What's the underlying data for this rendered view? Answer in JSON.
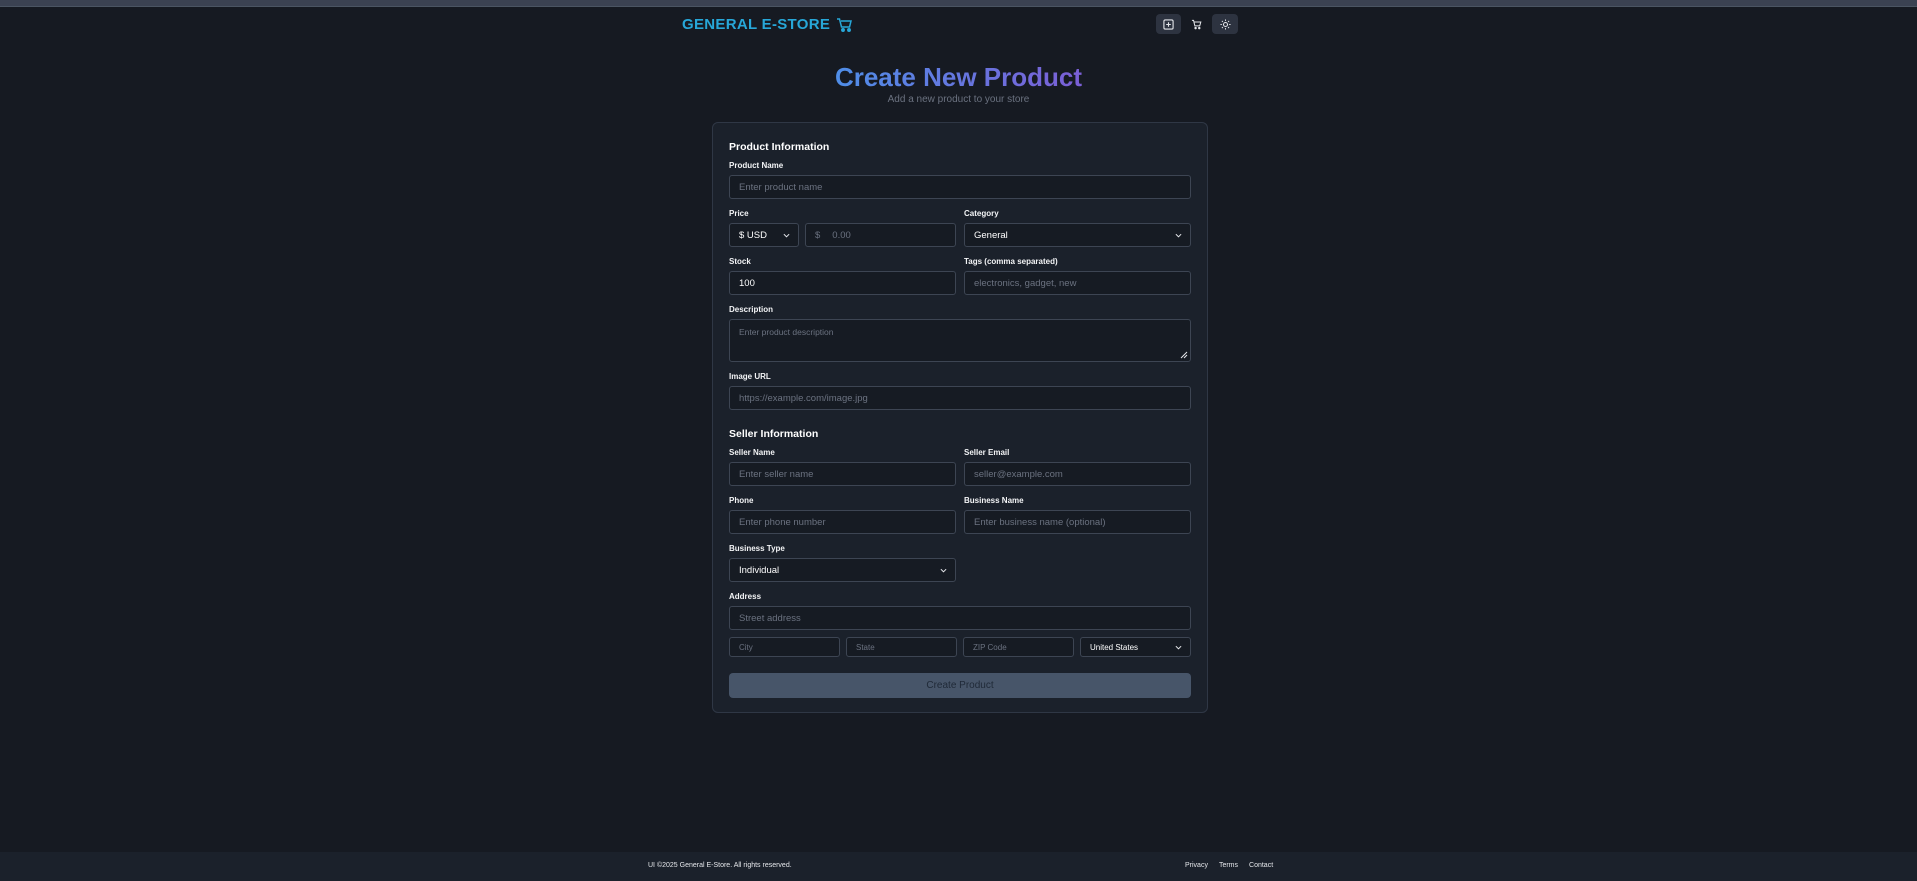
{
  "header": {
    "brand": "GENERAL E-STORE",
    "icons": [
      "cart-icon",
      "add-square-icon",
      "shopping-cart-icon",
      "sun-icon"
    ]
  },
  "page": {
    "title": "Create New Product",
    "subtitle": "Add a new product to your store"
  },
  "product_section": {
    "title": "Product Information",
    "name_label": "Product Name",
    "name_placeholder": "Enter product name",
    "price_label": "Price",
    "currency_value": "$ USD",
    "price_symbol": "$",
    "price_placeholder": "0.00",
    "category_label": "Category",
    "category_value": "General",
    "stock_label": "Stock",
    "stock_value": "100",
    "tags_label": "Tags (comma separated)",
    "tags_placeholder": "electronics, gadget, new",
    "description_label": "Description",
    "description_placeholder": "Enter product description",
    "image_label": "Image URL",
    "image_placeholder": "https://example.com/image.jpg"
  },
  "seller_section": {
    "title": "Seller Information",
    "name_label": "Seller Name",
    "name_placeholder": "Enter seller name",
    "email_label": "Seller Email",
    "email_placeholder": "seller@example.com",
    "phone_label": "Phone",
    "phone_placeholder": "Enter phone number",
    "business_name_label": "Business Name",
    "business_name_placeholder": "Enter business name (optional)",
    "business_type_label": "Business Type",
    "business_type_value": "Individual",
    "address_label": "Address",
    "street_placeholder": "Street address",
    "city_placeholder": "City",
    "state_placeholder": "State",
    "zip_placeholder": "ZIP Code",
    "country_value": "United States"
  },
  "submit_label": "Create Product",
  "footer": {
    "copyright": "UI ©2025 General E-Store. All rights reserved.",
    "links": [
      "Privacy",
      "Terms",
      "Contact"
    ]
  },
  "colors": {
    "background": "#161a22",
    "card": "#1b212b",
    "brand": "#27a7d8",
    "title_gradient_start": "#4f8ee8",
    "title_gradient_end": "#7b5fd6",
    "submit_button": "#475569"
  }
}
